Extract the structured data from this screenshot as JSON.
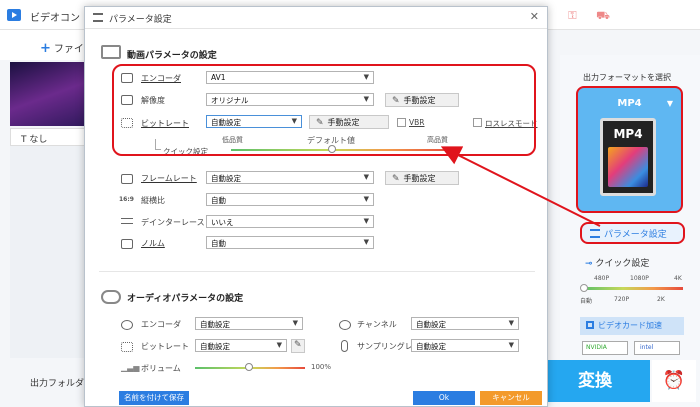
{
  "app": {
    "title": "ビデオコン",
    "add_file": "ファイル",
    "subtitle": "なし",
    "output_folder": "出力フォルダ："
  },
  "right_panel": {
    "format_title": "出力フォーマットを選択",
    "format_name": "MP4",
    "format_icon_label": "MP4",
    "param_button": "パラメータ設定",
    "quick_label": "クイック設定",
    "quick_top_ticks": [
      "480P",
      "1080P",
      "4K"
    ],
    "quick_bottom_ticks": [
      "自動",
      "720P",
      "2K"
    ],
    "gpu_button": "ビデオカード加速",
    "nvidia": "NVIDIA",
    "intel": "intel",
    "convert_button": "変換",
    "alarm_icon": "alarm-icon"
  },
  "dialog": {
    "title": "パラメータ設定",
    "video_section": "動画パラメータの設定",
    "audio_section": "オーディオパラメータの設定",
    "video": {
      "encoder_label": "エンコーダ",
      "encoder_value": "AV1",
      "resolution_label": "解像度",
      "resolution_value": "オリジナル",
      "manual_button": "手動設定",
      "bitrate_label": "ビットレート",
      "bitrate_value": "自動設定",
      "bitrate_manual_button": "手動設定",
      "vbr_label": "VBR",
      "lossless_label": "ロスレスモード",
      "quick_setting_label": "クイック設定",
      "quality_low": "低品質",
      "quality_default": "デフォルト値",
      "quality_high": "高品質",
      "framerate_label": "フレームレート",
      "framerate_value": "自動設定",
      "framerate_manual_button": "手動設定",
      "aspect_label": "縦横比",
      "aspect_value": "自動",
      "deinterlace_label": "デインターレース",
      "deinterlace_value": "いいえ",
      "normal_label": "ノルム",
      "normal_value": "自動"
    },
    "audio": {
      "encoder_label": "エンコーダ",
      "encoder_value": "自動設定",
      "channel_label": "チャンネル",
      "channel_value": "自動設定",
      "bitrate_label": "ビットレート",
      "bitrate_value": "自動設定",
      "samplerate_label": "サンプリングレート",
      "samplerate_value": "自動設定",
      "volume_label": "ボリューム",
      "volume_value": "100%"
    },
    "footer": {
      "save_as": "名前を付けて保存",
      "ok": "Ok",
      "cancel": "キャンセル"
    }
  },
  "colors": {
    "accent": "#2b7de1",
    "highlight": "#e0141c",
    "convert": "#25a7f0",
    "cancel": "#f39a2b",
    "ok": "#2b7de1"
  }
}
